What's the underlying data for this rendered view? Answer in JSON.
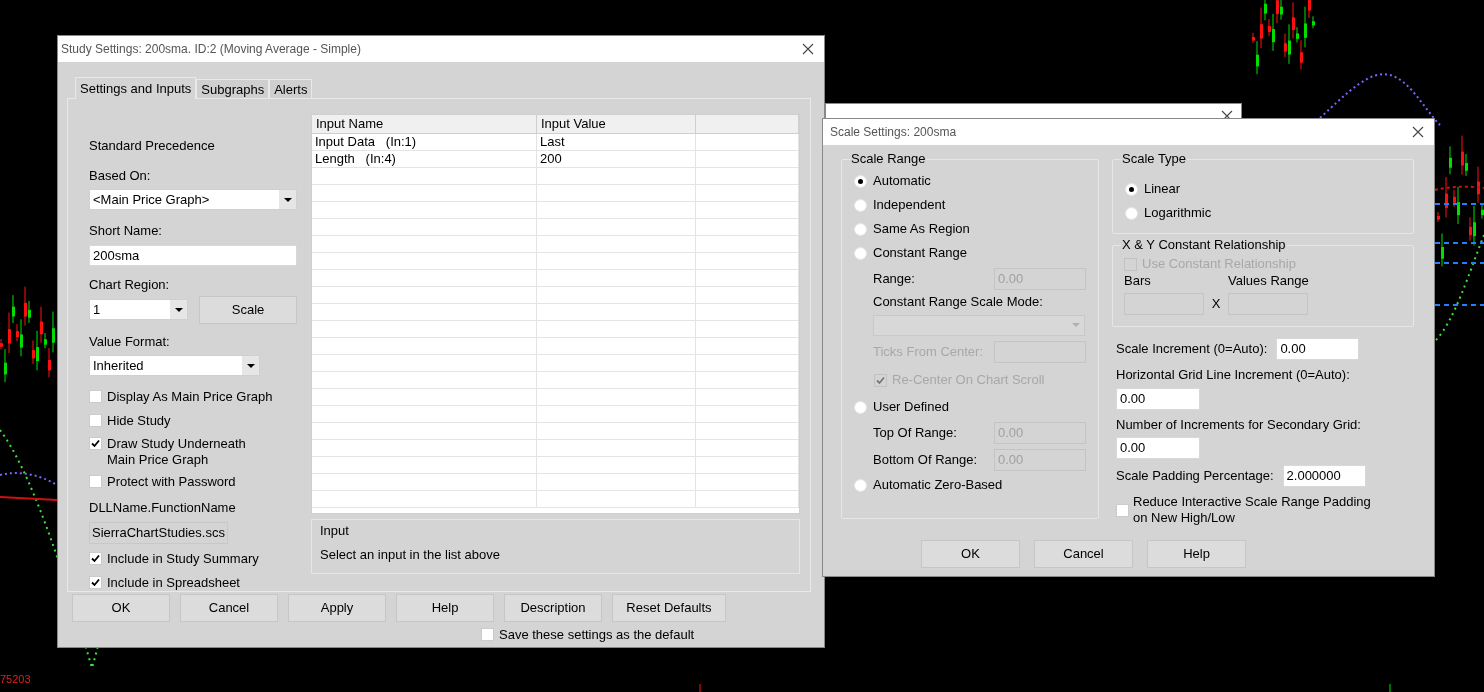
{
  "chart": {
    "price_label": "75203"
  },
  "study_window": {
    "title": "Study Settings: 200sma. ID:2 (Moving Average - Simple)",
    "tabs": [
      {
        "label": "Settings and Inputs",
        "selected": true
      },
      {
        "label": "Subgraphs",
        "selected": false
      },
      {
        "label": "Alerts",
        "selected": false
      }
    ],
    "precedence": "Standard Precedence",
    "based_on": {
      "label": "Based On:",
      "value": "<Main Price Graph>"
    },
    "short_name": {
      "label": "Short Name:",
      "value": "200sma"
    },
    "chart_region": {
      "label": "Chart Region:",
      "value": "1",
      "button": "Scale"
    },
    "value_format": {
      "label": "Value Format:",
      "value": "Inherited"
    },
    "options": [
      {
        "label": "Display As Main Price Graph",
        "checked": false
      },
      {
        "label": "Hide Study",
        "checked": false
      },
      {
        "label": "Draw Study Underneath\nMain Price Graph",
        "checked": true
      },
      {
        "label": "Protect with Password",
        "checked": false
      }
    ],
    "dll": {
      "label": "DLLName.FunctionName",
      "value": "SierraChartStudies.scs"
    },
    "include_options": [
      {
        "label": "Include in Study Summary",
        "checked": true
      },
      {
        "label": "Include in Spreadsheet",
        "checked": true
      }
    ],
    "inputs_table": {
      "columns": [
        "Input Name",
        "Input Value"
      ],
      "rows": [
        [
          "Input Data   (In:1)",
          "Last"
        ],
        [
          "Length   (In:4)",
          "200"
        ]
      ]
    },
    "input_help": {
      "title": "Input",
      "text": "Select an input in the list above"
    },
    "buttons": [
      "OK",
      "Cancel",
      "Apply",
      "Help",
      "Description",
      "Reset Defaults"
    ],
    "save_default": {
      "label": "Save these settings as the default",
      "checked": false
    }
  },
  "scale_window": {
    "title": "Scale Settings: 200sma",
    "range_group": {
      "title": "Scale Range",
      "items": [
        {
          "kind": "radio",
          "label": "Automatic",
          "selected": true
        },
        {
          "kind": "radio",
          "label": "Independent",
          "selected": false
        },
        {
          "kind": "radio",
          "label": "Same As Region",
          "selected": false
        },
        {
          "kind": "radio",
          "label": "Constant Range",
          "selected": false
        },
        {
          "kind": "field",
          "label": "Range:",
          "value": "0.00",
          "disabled": true,
          "label_disabled": false
        },
        {
          "kind": "label",
          "label": "Constant Range Scale Mode:"
        },
        {
          "kind": "dropdown",
          "disabled": true
        },
        {
          "kind": "field",
          "label": "Ticks From Center:",
          "disabled": true,
          "label_disabled": true
        },
        {
          "kind": "checkbox",
          "label": "Re-Center On Chart Scroll",
          "checked": true,
          "disabled": true
        },
        {
          "kind": "radio",
          "label": "User Defined",
          "selected": false
        },
        {
          "kind": "field",
          "label": "Top Of Range:",
          "value": "0.00",
          "disabled": true,
          "label_disabled": false
        },
        {
          "kind": "field",
          "label": "Bottom Of Range:",
          "value": "0.00",
          "disabled": true,
          "label_disabled": false
        },
        {
          "kind": "radio",
          "label": "Automatic Zero-Based",
          "selected": false
        }
      ]
    },
    "type_group": {
      "title": "Scale Type",
      "items": [
        {
          "label": "Linear",
          "selected": true
        },
        {
          "label": "Logarithmic",
          "selected": false
        }
      ]
    },
    "xy_group": {
      "title": "X & Y Constant Relationship",
      "checkbox": {
        "label": "Use Constant Relationship",
        "checked": false,
        "disabled": true
      },
      "bars_label": "Bars",
      "values_label": "Values Range",
      "times": "X"
    },
    "fields": [
      {
        "kind": "inline",
        "label": "Scale Increment (0=Auto):",
        "value": "0.00"
      },
      {
        "kind": "stacked",
        "label": "Horizontal Grid Line Increment (0=Auto):",
        "value": "0.00"
      },
      {
        "kind": "stacked",
        "label": "Number of Increments for Secondary Grid:",
        "value": "0.00"
      },
      {
        "kind": "inline",
        "label": "Scale Padding Percentage:",
        "value": "2.000000"
      }
    ],
    "reduce_padding": {
      "label": "Reduce Interactive Scale Range Padding\non New High/Low",
      "checked": false
    },
    "buttons": [
      "OK",
      "Cancel",
      "Help"
    ]
  }
}
